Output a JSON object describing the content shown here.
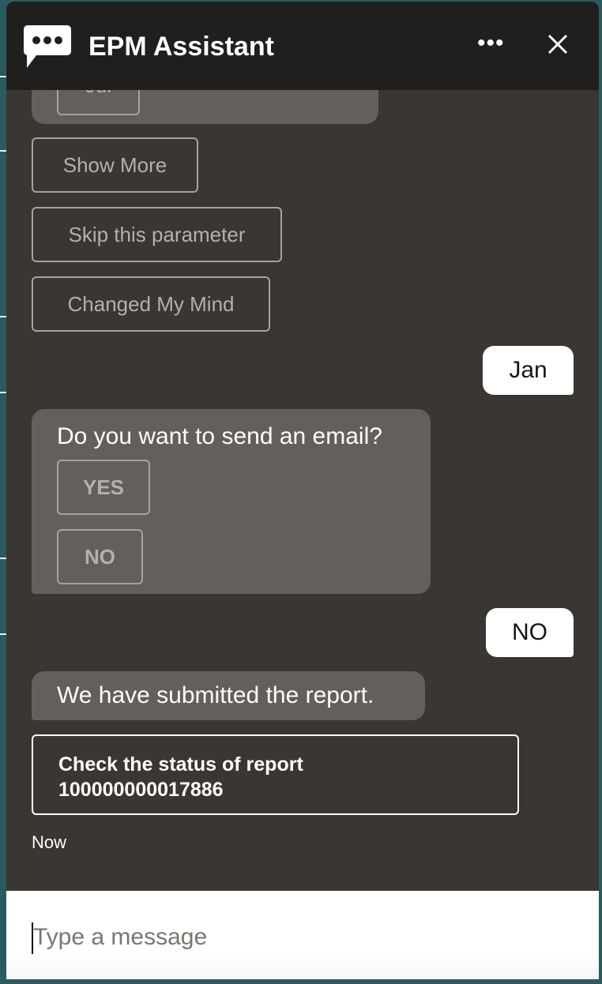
{
  "header": {
    "title": "EPM Assistant",
    "more_label": "•••",
    "icons": {
      "logo": "chat-bubble-icon",
      "more": "more-horizontal-icon",
      "close": "close-icon"
    }
  },
  "conversation": {
    "clipped_option": "Jul",
    "actions": [
      "Show More",
      "Skip this parameter",
      "Changed My Mind"
    ],
    "user_reply_1": "Jan",
    "question": {
      "text": "Do you want to send an email?",
      "options": [
        "YES",
        "NO"
      ]
    },
    "user_reply_2": "NO",
    "bot_message": "We have submitted the report.",
    "card": {
      "line1": "Check the status of report",
      "line2": "100000000017886"
    },
    "timestamp": "Now"
  },
  "composer": {
    "placeholder": "Type a message"
  },
  "colors": {
    "header": "#201f1d",
    "body": "#3a3632",
    "bubble": "#655f5b",
    "background": "#2b5a61"
  }
}
